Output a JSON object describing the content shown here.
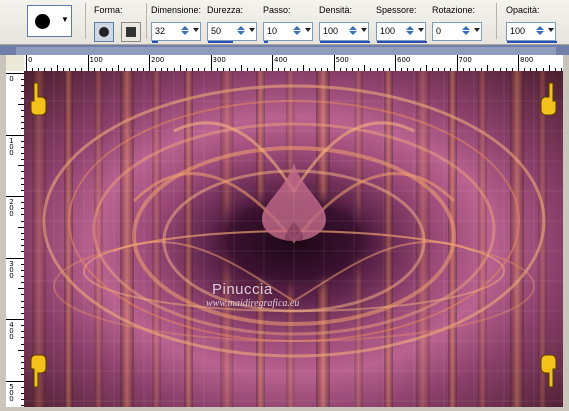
{
  "toolbar": {
    "shape_label": "Forma:",
    "size_label": "Dimensione:",
    "size_value": "32",
    "hardness_label": "Durezza:",
    "hardness_value": "50",
    "step_label": "Passo:",
    "step_value": "10",
    "density_label": "Densità:",
    "density_value": "100",
    "thickness_label": "Spessore:",
    "thickness_value": "100",
    "rotation_label": "Rotazione:",
    "rotation_value": "0",
    "opacity_label": "Opacità:",
    "opacity_value": "100"
  },
  "ruler": {
    "h_labels": [
      "0",
      "100",
      "200",
      "300",
      "400",
      "500",
      "600",
      "700",
      "800"
    ],
    "v_labels": [
      "0",
      "100",
      "200",
      "300",
      "400",
      "500"
    ]
  },
  "canvas": {
    "watermark_name": "Pinuccia",
    "watermark_url": "www.maidiregrafica.eu"
  },
  "colors": {
    "accent": "#3d6fb8",
    "canvas_dark": "#2a0c22",
    "canvas_mid": "#b9628f",
    "canvas_orange": "#f08a4a",
    "hand": "#f2c21a"
  }
}
